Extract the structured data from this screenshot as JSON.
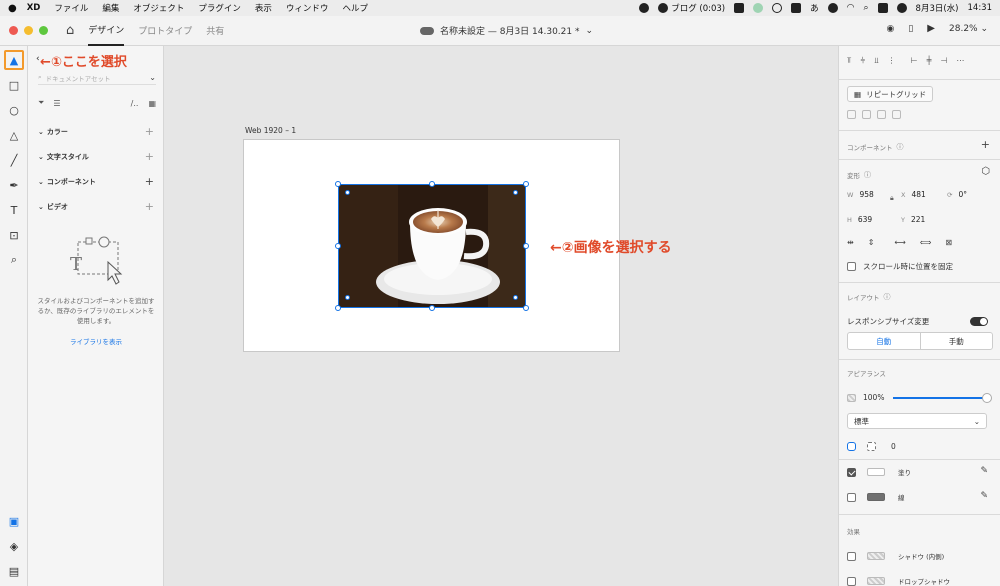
{
  "menubar": {
    "apple": "",
    "app": "XD",
    "items": [
      "ファイル",
      "編集",
      "オブジェクト",
      "プラグイン",
      "表示",
      "ウィンドウ",
      "ヘルプ"
    ],
    "status_text": "ブログ (0:03)",
    "kana": "あ",
    "date": "8月3日(水)",
    "time": "14:31"
  },
  "titlebar": {
    "tabs": [
      "デザイン",
      "プロトタイプ",
      "共有"
    ],
    "doc_title": "名称未設定 — 8月3日 14.30.21 *",
    "zoom": "28.2%"
  },
  "assets": {
    "search_placeholder": "ドキュメントアセット",
    "sections": [
      "カラー",
      "文字スタイル",
      "コンポーネント",
      "ビデオ"
    ],
    "empty_text": "スタイルおよびコンポーネントを追加するか、既存のライブラリのエレメントを使用します。",
    "library_link": "ライブラリを表示"
  },
  "canvas": {
    "artboard_label": "Web 1920 – 1"
  },
  "annotations": {
    "step1": "←①ここを選択",
    "step2": "←②画像を選択する"
  },
  "props": {
    "repeat_grid": "リピートグリッド",
    "component_header": "コンポーネント",
    "transform_header": "変形",
    "w_label": "W",
    "w": "958",
    "x_label": "X",
    "x": "481",
    "rotate": "0°",
    "h_label": "H",
    "h": "639",
    "y_label": "Y",
    "y": "221",
    "fix_scroll": "スクロール時に位置を固定",
    "layout_header": "レイアウト",
    "responsive": "レスポンシブサイズ変更",
    "auto": "自動",
    "manual": "手動",
    "appearance_header": "アピアランス",
    "opacity": "100%",
    "opacity_value": 1.0,
    "blend": "標準",
    "corner_radius": "0",
    "fill_label": "塗り",
    "stroke_label": "線",
    "effects_header": "効果",
    "inner_shadow": "シャドウ (内側)",
    "drop_shadow": "ドロップシャドウ"
  },
  "colors": {
    "accent": "#1473e6",
    "annotation": "#e04a2a",
    "tool_highlight": "#f39a2c"
  }
}
